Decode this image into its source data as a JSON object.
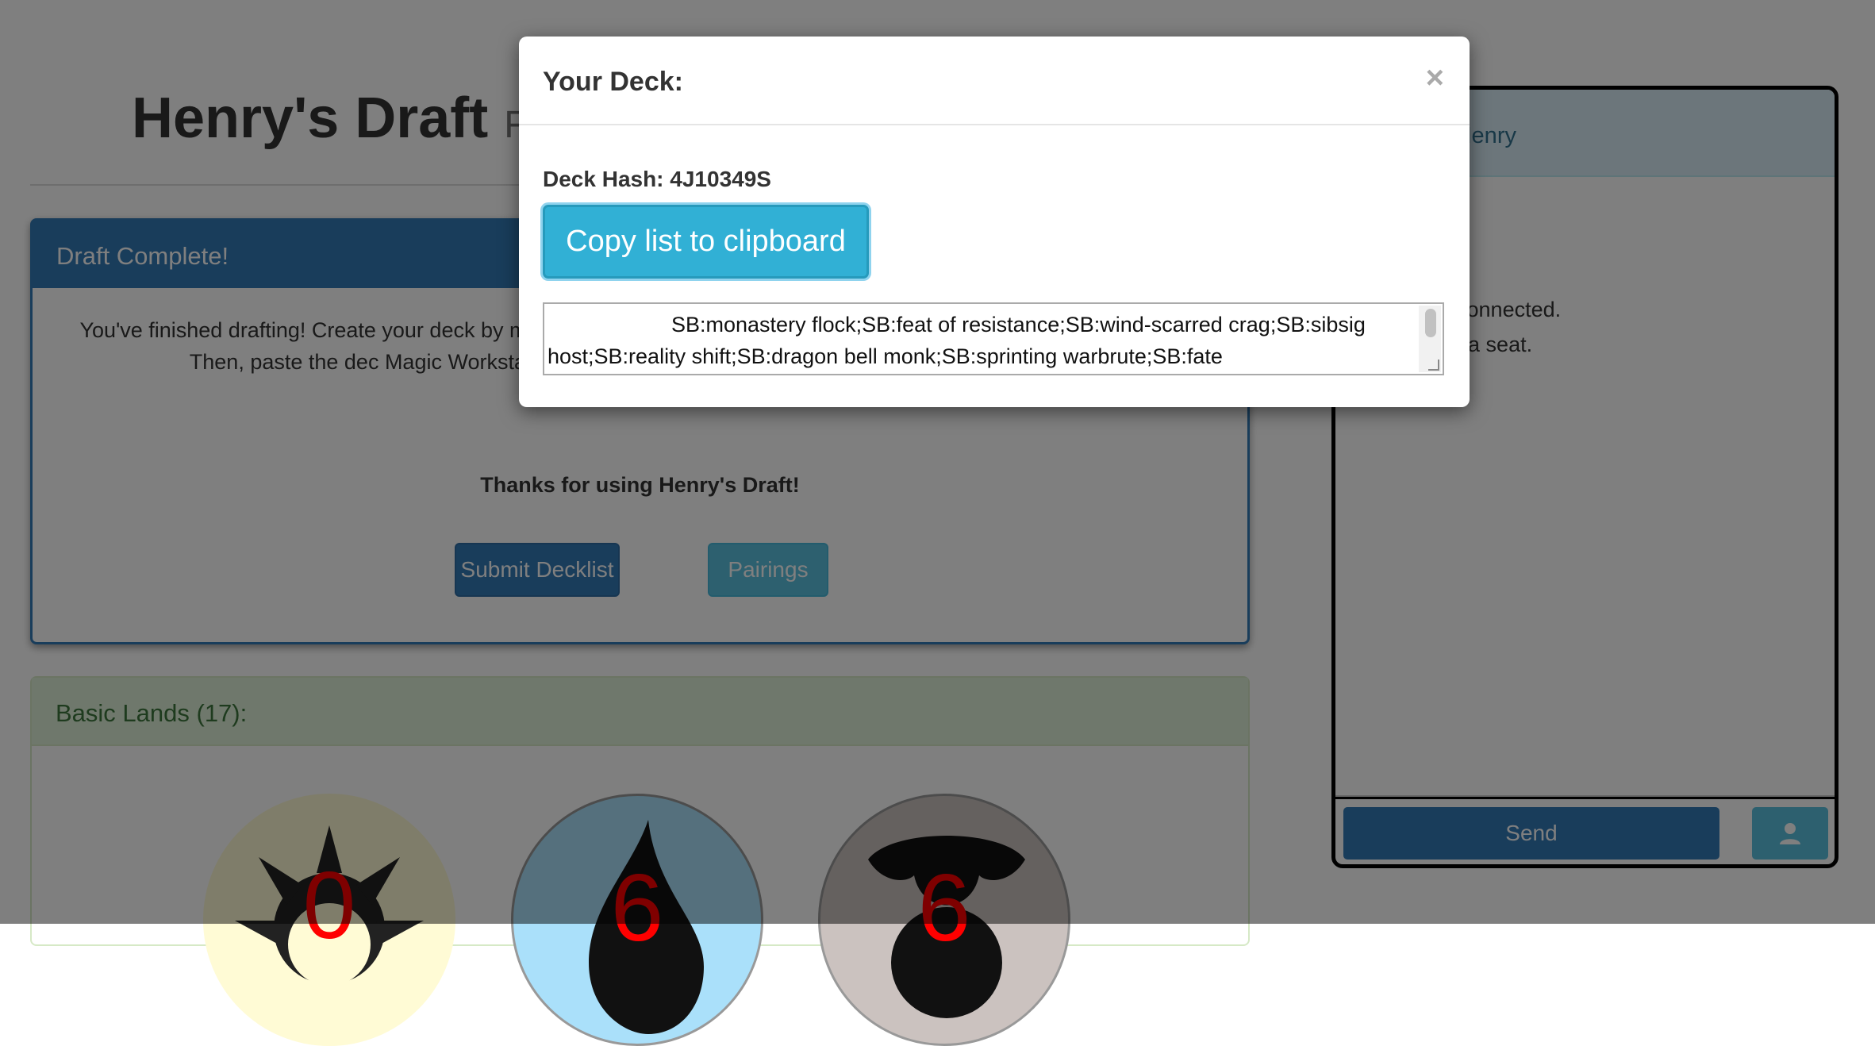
{
  "page": {
    "title": "Henry's Draft",
    "title_sub": "Fi"
  },
  "draft_panel": {
    "heading": "Draft Complete!",
    "body": "You've finished drafting! Create your deck by m add basic lands to your deck! Once you have copied to your clipboard. Then, paste the dec Magic Workstation. You can click 'Pairings' to see who you are paired with.",
    "thanks": "Thanks for using Henry's Draft!",
    "submit_label": "Submit Decklist",
    "pairings_label": "Pairings"
  },
  "lands_panel": {
    "heading": "Basic Lands (17):",
    "counts": [
      "0",
      "6",
      "6"
    ]
  },
  "chat": {
    "header": "s: Henry",
    "lines": [
      "as connected.",
      "ken a seat."
    ],
    "send_label": "Send",
    "user_icon": "user-icon"
  },
  "modal": {
    "title": "Your Deck:",
    "close": "×",
    "deck_hash": "Deck Hash: 4J10349S",
    "copy_label": "Copy list to clipboard",
    "deck_text": "SB:monastery flock;SB:feat of resistance;SB:wind-scarred crag;SB:sibsig host;SB:reality shift;SB:dragon bell monk;SB:sprinting warbrute;SB:fate"
  },
  "colors": {
    "primary": "#337ab7",
    "info": "#5bc0de",
    "success_bg": "#dff0d8",
    "mana_number": "#ff0000"
  }
}
